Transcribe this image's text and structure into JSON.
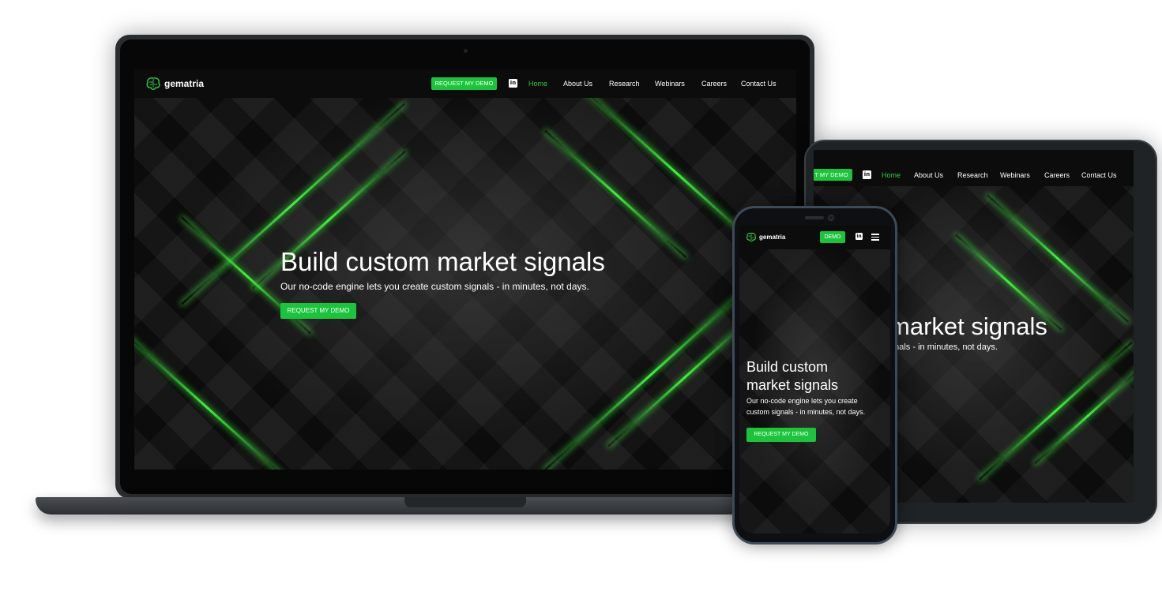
{
  "brand": {
    "name": "gematria",
    "accent": "#1bc53b"
  },
  "laptop": {
    "nav": {
      "cta": "REQUEST MY DEMO",
      "social_icon": "linkedin-icon",
      "links": [
        "Home",
        "About Us",
        "Research",
        "Webinars",
        "Careers",
        "Contact Us"
      ]
    },
    "hero": {
      "title": "Build custom market signals",
      "subtitle": "Our no-code engine lets you create custom signals - in minutes, not days.",
      "cta": "REQUEST MY DEMO"
    }
  },
  "tablet": {
    "nav": {
      "cta": "T MY DEMO",
      "links": [
        "Home",
        "About Us",
        "Research",
        "Webinars",
        "Careers",
        "Contact Us"
      ]
    },
    "hero": {
      "title": "market signals",
      "subtitle": "gnals - in minutes, not days."
    }
  },
  "phone": {
    "nav": {
      "cta": "DEMO",
      "menu_icon": "hamburger-icon"
    },
    "hero": {
      "title_line1": "Build custom",
      "title_line2": "market signals",
      "subtitle_line1": "Our no-code engine lets you create",
      "subtitle_line2": "custom signals - in minutes, not days.",
      "cta": "REQUEST MY DEMO"
    }
  }
}
